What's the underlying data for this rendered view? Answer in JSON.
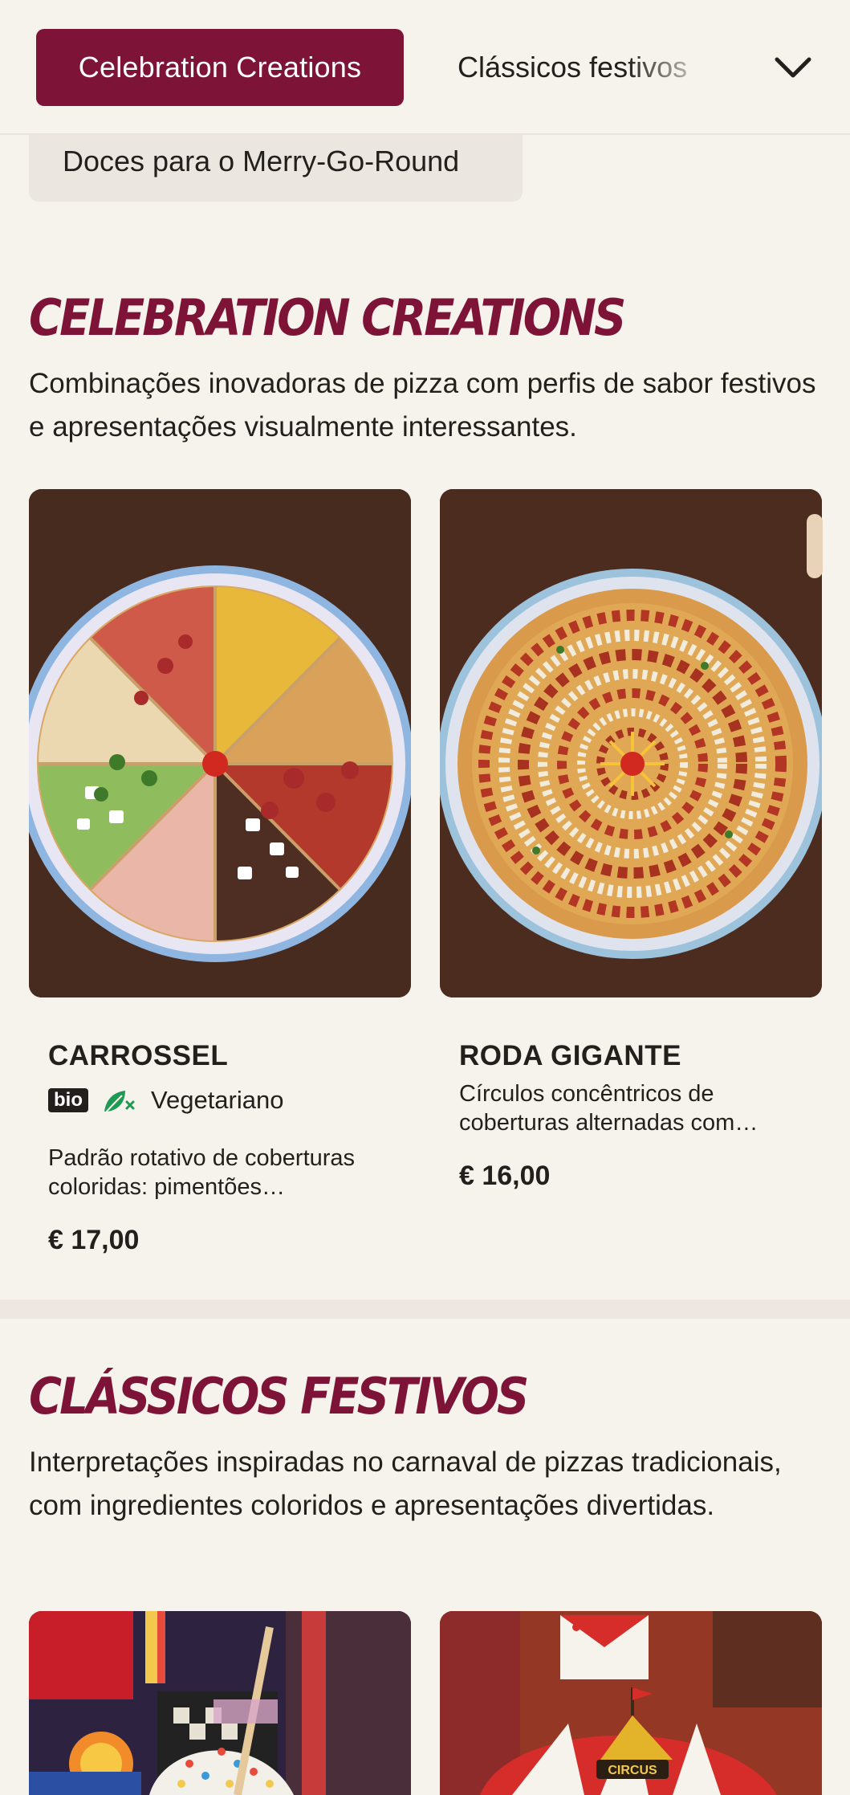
{
  "category_nav": {
    "active": "Celebration Creations",
    "tab_2": "Clássicos festivos",
    "tab_3": "Doces para o Merry-Go-Round",
    "toggle_icon": "chevron-down-icon"
  },
  "sections": [
    {
      "title": "Celebration Creations",
      "description": "Combinações inovadoras de pizza com perfis de sabor festivos e apresentações visualmente interessantes.",
      "products": [
        {
          "name": "CARROSSEL",
          "badge": "bio",
          "diet_icon": "vegetarian-leaf-icon",
          "diet": "Vegetariano",
          "description": "Padrão rotativo de coberturas coloridas: pimentões…",
          "price": "€ 17,00"
        },
        {
          "name": "RODA GIGANTE",
          "description": "Círculos concêntricos de coberturas alternadas com…",
          "price": "€ 16,00"
        }
      ]
    },
    {
      "title": "Clássicos festivos",
      "description": "Interpretações inspiradas no carnaval de pizzas tradicionais, com ingredientes coloridos e apresentações divertidas.",
      "products": [
        {
          "image_label": ""
        },
        {
          "image_label": "CIRCUS"
        }
      ]
    }
  ],
  "colors": {
    "brand": "#7d1438",
    "background": "#f6f2ec",
    "text": "#231f1c",
    "veg_green": "#1f9a55"
  }
}
